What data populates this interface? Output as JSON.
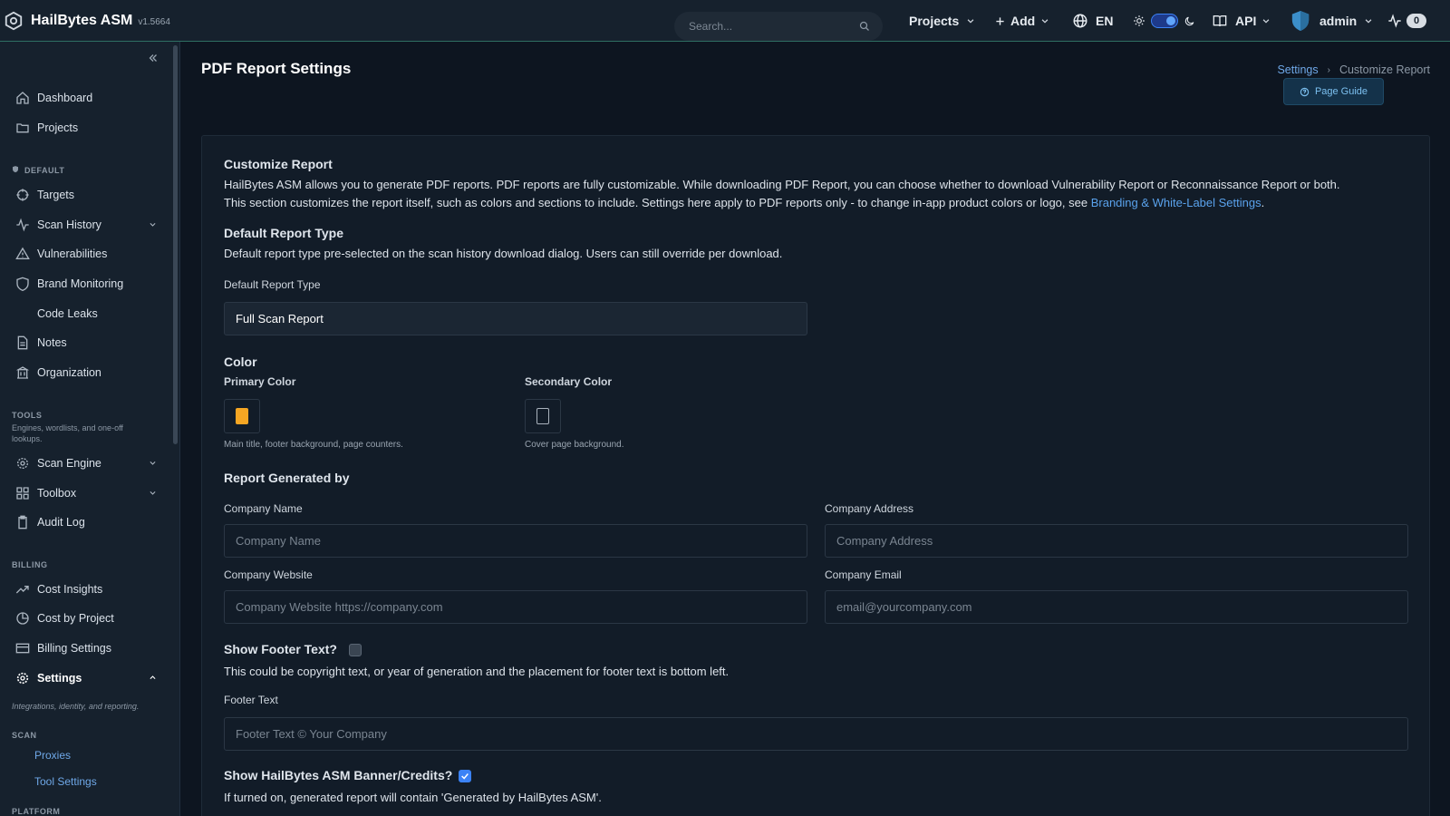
{
  "app": {
    "name": "HailBytes ASM",
    "version": "v1.5664"
  },
  "topbar": {
    "search_placeholder": "Search...",
    "projects_label": "Projects",
    "add_label": "Add",
    "lang_label": "EN",
    "api_label": "API",
    "user_label": "admin",
    "notifications_count": "0"
  },
  "sidebar": {
    "items_top": [
      {
        "label": "Dashboard",
        "icon": "home-icon"
      },
      {
        "label": "Projects",
        "icon": "folder-icon"
      }
    ],
    "section_default": "DEFAULT",
    "items_default": [
      {
        "label": "Targets",
        "icon": "crosshair-icon"
      },
      {
        "label": "Scan History",
        "icon": "activity-icon"
      },
      {
        "label": "Vulnerabilities",
        "icon": "warning-icon"
      },
      {
        "label": "Brand Monitoring",
        "icon": "shield-icon"
      },
      {
        "label": "Code Leaks"
      },
      {
        "label": "Notes",
        "icon": "document-icon"
      },
      {
        "label": "Organization",
        "icon": "building-icon"
      }
    ],
    "section_tools": "TOOLS",
    "tools_note": "Engines, wordlists, and one-off lookups.",
    "items_tools": [
      {
        "label": "Scan Engine",
        "icon": "gear-icon"
      },
      {
        "label": "Toolbox",
        "icon": "grid-icon"
      },
      {
        "label": "Audit Log",
        "icon": "clipboard-icon"
      }
    ],
    "section_billing": "BILLING",
    "items_billing": [
      {
        "label": "Cost Insights",
        "icon": "trend-icon"
      },
      {
        "label": "Cost by Project",
        "icon": "pie-icon"
      },
      {
        "label": "Billing Settings",
        "icon": "card-icon"
      }
    ],
    "settings_label": "Settings",
    "settings_note": "Integrations, identity, and reporting.",
    "section_scan": "SCAN",
    "scan_items": [
      "Proxies",
      "Tool Settings"
    ],
    "section_platform": "PLATFORM"
  },
  "page": {
    "title": "PDF Report Settings",
    "breadcrumb": {
      "parent": "Settings",
      "current": "Customize Report"
    },
    "guide_label": "Page Guide"
  },
  "form": {
    "customize_title": "Customize Report",
    "customize_desc_1": "HailBytes ASM allows you to generate PDF reports. PDF reports are fully customizable. While downloading PDF Report, you can choose whether to download Vulnerability Report or Reconnaissance Report or both.",
    "customize_desc_2": "This section customizes the report itself, such as colors and sections to include. Settings here apply to PDF reports only - to change in-app product colors or logo, see ",
    "customize_link": "Branding & White-Label Settings",
    "customize_desc_end": ".",
    "default_type_title": "Default Report Type",
    "default_type_desc": "Default report type pre-selected on the scan history download dialog. Users can still override per download.",
    "default_type_label": "Default Report Type",
    "default_type_value": "Full Scan Report",
    "color_title": "Color",
    "primary_label": "Primary Color",
    "primary_hint": "Main title, footer background, page counters.",
    "primary_color": "#f5a623",
    "secondary_label": "Secondary Color",
    "secondary_hint": "Cover page background.",
    "secondary_color": "#121c28",
    "generated_title": "Report Generated by",
    "company_name_label": "Company Name",
    "company_name_placeholder": "Company Name",
    "company_address_label": "Company Address",
    "company_address_placeholder": "Company Address",
    "company_website_label": "Company Website",
    "company_website_placeholder": "Company Website https://company.com",
    "company_email_label": "Company Email",
    "company_email_placeholder": "email@yourcompany.com",
    "footer_toggle_label": "Show Footer Text?",
    "footer_toggle_checked": false,
    "footer_desc": "This could be copyright text, or year of generation and the placement for footer text is bottom left.",
    "footer_text_label": "Footer Text",
    "footer_text_placeholder": "Footer Text © Your Company",
    "banner_toggle_label": "Show HailBytes ASM Banner/Credits?",
    "banner_toggle_checked": true,
    "banner_desc": "If turned on, generated report will contain 'Generated by HailBytes ASM'."
  }
}
